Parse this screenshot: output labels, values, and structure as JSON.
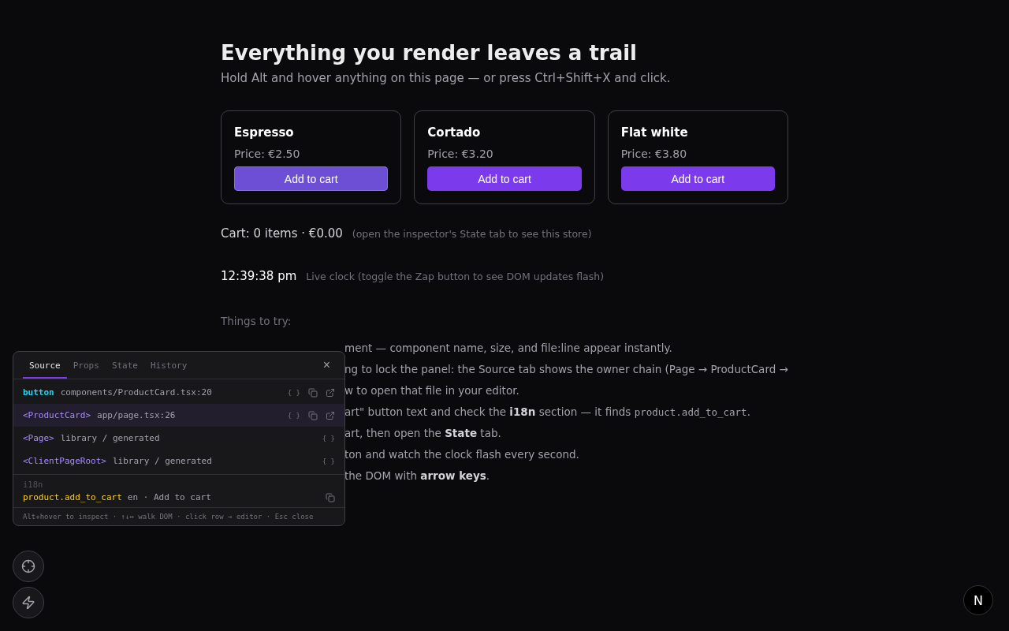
{
  "heading": "Everything you render leaves a trail",
  "subtitle": "Hold Alt and hover anything on this page — or press Ctrl+Shift+X and click.",
  "products": [
    {
      "name": "Espresso",
      "price": "Price: €2.50",
      "button": "Add to cart",
      "highlighted": true
    },
    {
      "name": "Cortado",
      "price": "Price: €3.20",
      "button": "Add to cart",
      "highlighted": false
    },
    {
      "name": "Flat white",
      "price": "Price: €3.80",
      "button": "Add to cart",
      "highlighted": false
    }
  ],
  "cart": {
    "summary": "Cart: 0 items · €0.00",
    "hint": "(open the inspector's State tab to see this store)"
  },
  "clock": {
    "time": "12:39:38 pm",
    "hint": "Live clock (toggle the Zap button to see DOM updates flash)"
  },
  "tips_heading": "Things to try:",
  "tips": [
    [
      {
        "kind": "plain",
        "text": "ment — component name, size, and file:line appear instantly."
      }
    ],
    [
      {
        "kind": "plain",
        "text": "ng to lock the panel: the Source tab shows the owner chain (Page → ProductCard →"
      }
    ],
    [
      {
        "kind": "plain",
        "text": "w to open that file in your editor."
      }
    ],
    [
      {
        "kind": "plain",
        "text": "art\" button text and check the "
      },
      {
        "kind": "bold",
        "text": "i18n"
      },
      {
        "kind": "plain",
        "text": " section — it finds "
      },
      {
        "kind": "code",
        "text": "product.add_to_cart"
      },
      {
        "kind": "plain",
        "text": "."
      }
    ],
    [
      {
        "kind": "plain",
        "text": "art, then open the "
      },
      {
        "kind": "bold",
        "text": "State"
      },
      {
        "kind": "plain",
        "text": " tab."
      }
    ],
    [
      {
        "kind": "plain",
        "text": "ton and watch the clock flash every second."
      }
    ],
    [
      {
        "kind": "plain",
        "text": "the DOM with "
      },
      {
        "kind": "bold",
        "text": "arrow keys"
      },
      {
        "kind": "plain",
        "text": "."
      }
    ]
  ],
  "inspector": {
    "tabs": [
      {
        "label": "Source",
        "selected": true
      },
      {
        "label": "Props",
        "selected": false
      },
      {
        "label": "State",
        "selected": false
      },
      {
        "label": "History",
        "selected": false
      }
    ],
    "close": "×",
    "chain": [
      {
        "kind": "element",
        "name": "button",
        "location": "components/ProductCard.tsx:20",
        "braces": "{ }",
        "has_copy": true,
        "has_open": true,
        "selected": false
      },
      {
        "kind": "component",
        "name": "<ProductCard>",
        "location": "app/page.tsx:26",
        "braces": "{ }",
        "has_copy": true,
        "has_open": true,
        "selected": true
      },
      {
        "kind": "component",
        "name": "<Page>",
        "location": "library / generated",
        "braces": "{ }",
        "has_copy": false,
        "has_open": false,
        "selected": false
      },
      {
        "kind": "component",
        "name": "<ClientPageRoot>",
        "location": "library / generated",
        "braces": "{ }",
        "has_copy": false,
        "has_open": false,
        "selected": false
      }
    ],
    "i18n": {
      "label": "i18n",
      "key": "product.add_to_cart",
      "locale": "en · Add to cart"
    },
    "footer": "Alt+hover to inspect · ↑↓↔ walk DOM · click row → editor · Esc close"
  },
  "badge": "N"
}
